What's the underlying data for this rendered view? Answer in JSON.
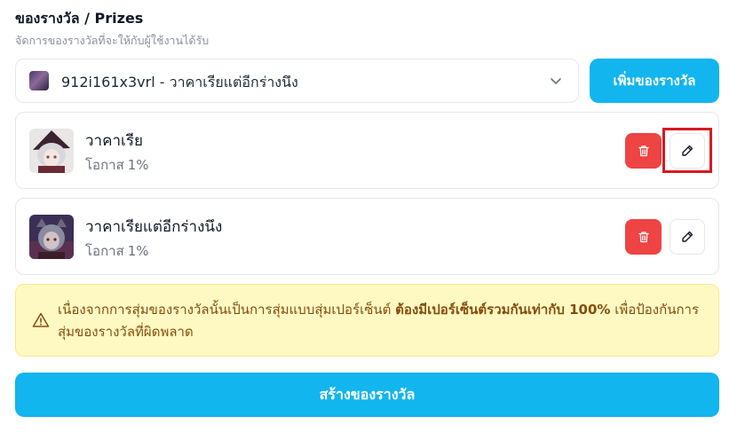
{
  "header": {
    "title": "ของรางวัล / Prizes",
    "subtitle": "จัดการของรางวัลที่จะให้กับผู้ใช้งานได้รับ"
  },
  "selector": {
    "code": "912i161x3vrl",
    "separator": " - ",
    "name": "วาคาเรียแต่อีกร่างนึง",
    "icon": "chevron-down-icon"
  },
  "add_button": {
    "label": "เพิ่มของรางวัล"
  },
  "prizes": [
    {
      "name": "วาคาเรีย",
      "chance_label": "โอกาส",
      "chance_value": "1%"
    },
    {
      "name": "วาคาเรียแต่อีกร่างนึง",
      "chance_label": "โอกาส",
      "chance_value": "1%"
    }
  ],
  "warning": {
    "text_before": "เนื่องจากการสุ่มของรางวัลนั้นเป็นการสุ่มแบบสุ่มเปอร์เซ็นต์ ",
    "text_bold": "ต้องมีเปอร์เซ็นต์รวมกันเท่ากับ 100%",
    "text_after": " เพื่อป้องกันการสุ่มของรางวัลที่ผิดพลาด",
    "icon": "warning-triangle-icon"
  },
  "create_button": {
    "label": "สร้างของรางวัล"
  },
  "colors": {
    "accent": "#12b5ee",
    "danger": "#ef4444",
    "warning_bg": "#fef9c3",
    "warning_text": "#854d0e",
    "highlight": "#d71920"
  }
}
